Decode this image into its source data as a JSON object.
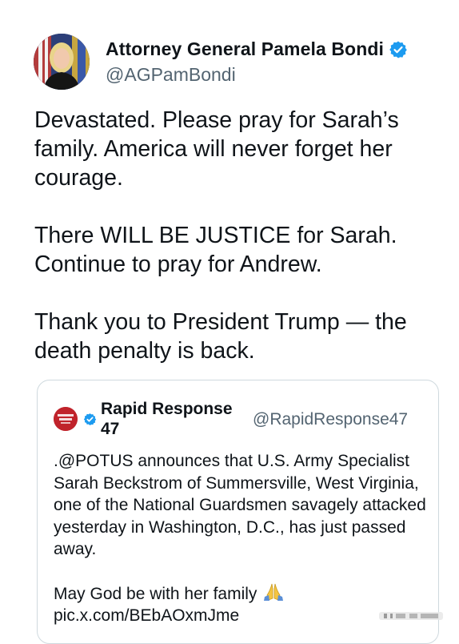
{
  "author": {
    "display_name": "Attorney General Pamela Bondi",
    "handle": "@AGPamBondi",
    "verified_icon": "verified-badge-icon"
  },
  "tweet": {
    "paragraphs": [
      "Devastated. Please pray for Sarah’s family. America will never forget her courage.",
      "There WILL BE JUSTICE for Sarah. Continue to pray for Andrew.",
      "Thank you to President Trump — the death penalty is back."
    ]
  },
  "quoted_tweet": {
    "display_name": "Rapid Response 47",
    "handle": "@RapidResponse47",
    "avatar_icon": "rapid-response-logo-icon",
    "paragraph_1": ".@POTUS announces that U.S. Army Specialist Sarah Beckstrom of Summersville, West Virginia, one of the National Guardsmen savagely attacked yesterday in Washington, D.C., has just passed away.",
    "paragraph_2": "May God be with her family",
    "emoji_icon": "folded-hands-icon",
    "link": "pic.x.com/BEbAOxmJme"
  },
  "colors": {
    "text": "#0f1419",
    "secondary_text": "#536471",
    "verified_blue": "#1d9bf0",
    "border": "#cfd9de",
    "rapid_response_red": "#c0232b"
  }
}
